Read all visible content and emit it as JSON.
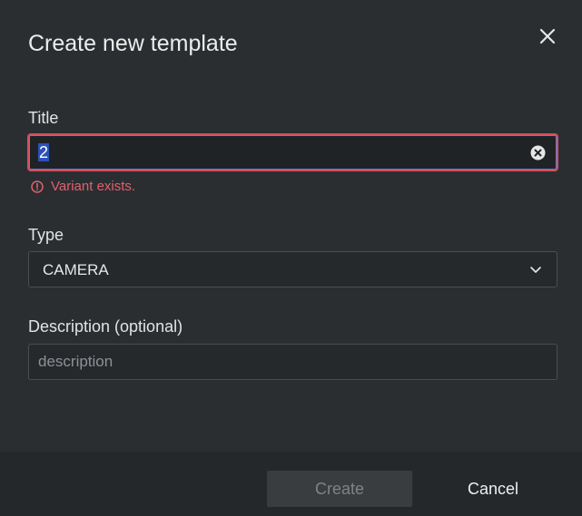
{
  "dialog": {
    "title": "Create new template"
  },
  "title_field": {
    "label": "Title",
    "value": "2",
    "error": "Variant exists.",
    "error_color": "#e0606e"
  },
  "type_field": {
    "label": "Type",
    "selected": "CAMERA"
  },
  "description_field": {
    "label": "Description (optional)",
    "placeholder": "description",
    "value": ""
  },
  "footer": {
    "create_label": "Create",
    "cancel_label": "Cancel"
  },
  "icons": {
    "close": "close-icon",
    "clear": "clear-circle-icon",
    "error": "alert-circle-icon",
    "dropdown": "chevron-down-icon"
  },
  "colors": {
    "background": "#2b2e31",
    "footer_background": "#25282a",
    "error_border": "#d0505e",
    "selection": "#2b52b8"
  }
}
